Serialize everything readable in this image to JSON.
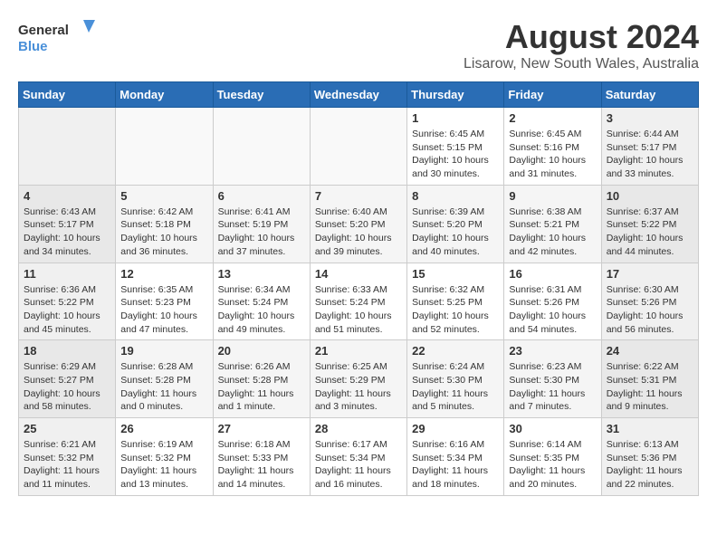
{
  "logo": {
    "line1": "General",
    "line2": "Blue"
  },
  "title": "August 2024",
  "subtitle": "Lisarow, New South Wales, Australia",
  "weekdays": [
    "Sunday",
    "Monday",
    "Tuesday",
    "Wednesday",
    "Thursday",
    "Friday",
    "Saturday"
  ],
  "weeks": [
    [
      {
        "day": "",
        "content": ""
      },
      {
        "day": "",
        "content": ""
      },
      {
        "day": "",
        "content": ""
      },
      {
        "day": "",
        "content": ""
      },
      {
        "day": "1",
        "content": "Sunrise: 6:45 AM\nSunset: 5:15 PM\nDaylight: 10 hours\nand 30 minutes."
      },
      {
        "day": "2",
        "content": "Sunrise: 6:45 AM\nSunset: 5:16 PM\nDaylight: 10 hours\nand 31 minutes."
      },
      {
        "day": "3",
        "content": "Sunrise: 6:44 AM\nSunset: 5:17 PM\nDaylight: 10 hours\nand 33 minutes."
      }
    ],
    [
      {
        "day": "4",
        "content": "Sunrise: 6:43 AM\nSunset: 5:17 PM\nDaylight: 10 hours\nand 34 minutes."
      },
      {
        "day": "5",
        "content": "Sunrise: 6:42 AM\nSunset: 5:18 PM\nDaylight: 10 hours\nand 36 minutes."
      },
      {
        "day": "6",
        "content": "Sunrise: 6:41 AM\nSunset: 5:19 PM\nDaylight: 10 hours\nand 37 minutes."
      },
      {
        "day": "7",
        "content": "Sunrise: 6:40 AM\nSunset: 5:20 PM\nDaylight: 10 hours\nand 39 minutes."
      },
      {
        "day": "8",
        "content": "Sunrise: 6:39 AM\nSunset: 5:20 PM\nDaylight: 10 hours\nand 40 minutes."
      },
      {
        "day": "9",
        "content": "Sunrise: 6:38 AM\nSunset: 5:21 PM\nDaylight: 10 hours\nand 42 minutes."
      },
      {
        "day": "10",
        "content": "Sunrise: 6:37 AM\nSunset: 5:22 PM\nDaylight: 10 hours\nand 44 minutes."
      }
    ],
    [
      {
        "day": "11",
        "content": "Sunrise: 6:36 AM\nSunset: 5:22 PM\nDaylight: 10 hours\nand 45 minutes."
      },
      {
        "day": "12",
        "content": "Sunrise: 6:35 AM\nSunset: 5:23 PM\nDaylight: 10 hours\nand 47 minutes."
      },
      {
        "day": "13",
        "content": "Sunrise: 6:34 AM\nSunset: 5:24 PM\nDaylight: 10 hours\nand 49 minutes."
      },
      {
        "day": "14",
        "content": "Sunrise: 6:33 AM\nSunset: 5:24 PM\nDaylight: 10 hours\nand 51 minutes."
      },
      {
        "day": "15",
        "content": "Sunrise: 6:32 AM\nSunset: 5:25 PM\nDaylight: 10 hours\nand 52 minutes."
      },
      {
        "day": "16",
        "content": "Sunrise: 6:31 AM\nSunset: 5:26 PM\nDaylight: 10 hours\nand 54 minutes."
      },
      {
        "day": "17",
        "content": "Sunrise: 6:30 AM\nSunset: 5:26 PM\nDaylight: 10 hours\nand 56 minutes."
      }
    ],
    [
      {
        "day": "18",
        "content": "Sunrise: 6:29 AM\nSunset: 5:27 PM\nDaylight: 10 hours\nand 58 minutes."
      },
      {
        "day": "19",
        "content": "Sunrise: 6:28 AM\nSunset: 5:28 PM\nDaylight: 11 hours\nand 0 minutes."
      },
      {
        "day": "20",
        "content": "Sunrise: 6:26 AM\nSunset: 5:28 PM\nDaylight: 11 hours\nand 1 minute."
      },
      {
        "day": "21",
        "content": "Sunrise: 6:25 AM\nSunset: 5:29 PM\nDaylight: 11 hours\nand 3 minutes."
      },
      {
        "day": "22",
        "content": "Sunrise: 6:24 AM\nSunset: 5:30 PM\nDaylight: 11 hours\nand 5 minutes."
      },
      {
        "day": "23",
        "content": "Sunrise: 6:23 AM\nSunset: 5:30 PM\nDaylight: 11 hours\nand 7 minutes."
      },
      {
        "day": "24",
        "content": "Sunrise: 6:22 AM\nSunset: 5:31 PM\nDaylight: 11 hours\nand 9 minutes."
      }
    ],
    [
      {
        "day": "25",
        "content": "Sunrise: 6:21 AM\nSunset: 5:32 PM\nDaylight: 11 hours\nand 11 minutes."
      },
      {
        "day": "26",
        "content": "Sunrise: 6:19 AM\nSunset: 5:32 PM\nDaylight: 11 hours\nand 13 minutes."
      },
      {
        "day": "27",
        "content": "Sunrise: 6:18 AM\nSunset: 5:33 PM\nDaylight: 11 hours\nand 14 minutes."
      },
      {
        "day": "28",
        "content": "Sunrise: 6:17 AM\nSunset: 5:34 PM\nDaylight: 11 hours\nand 16 minutes."
      },
      {
        "day": "29",
        "content": "Sunrise: 6:16 AM\nSunset: 5:34 PM\nDaylight: 11 hours\nand 18 minutes."
      },
      {
        "day": "30",
        "content": "Sunrise: 6:14 AM\nSunset: 5:35 PM\nDaylight: 11 hours\nand 20 minutes."
      },
      {
        "day": "31",
        "content": "Sunrise: 6:13 AM\nSunset: 5:36 PM\nDaylight: 11 hours\nand 22 minutes."
      }
    ]
  ]
}
